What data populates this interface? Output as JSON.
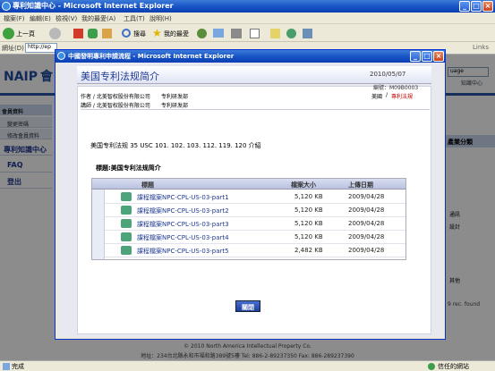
{
  "browser": {
    "title": "專利知識中心 - Microsoft Internet Explorer",
    "menu": [
      "檔案(F)",
      "編輯(E)",
      "檢視(V)",
      "我的最愛(A)",
      "工具(T)",
      "說明(H)"
    ],
    "toolbar": {
      "back_label": "上一頁",
      "search_label": "搜尋",
      "favorites_label": "我的最愛"
    },
    "address_label": "網址(D)",
    "address_value": "http://ep",
    "links_label": "Links",
    "status_left": "完成",
    "status_right": "信任的網站"
  },
  "page": {
    "logo_text": "NAIP",
    "logo_sub": "會",
    "header_right": "知識中心",
    "lang_select": "uage",
    "side": {
      "member_header": "會員資料",
      "items": [
        "變更密碼",
        "修改會員資料"
      ],
      "nav": [
        "專利知識中心",
        "FAQ",
        "登出"
      ]
    },
    "right_col": {
      "header": "產業分類",
      "items": [
        "通訊",
        "設計",
        "其他"
      ],
      "footer": "9 rec. found"
    },
    "footer_copy": "© 2010 North America Intellectual Property Co.",
    "footer_addr": "地址：234台北縣永和市福和路389號5樓  Tel: 886-2-89237350  Fax: 886-289237390"
  },
  "popup": {
    "title": "中國發明專利申請流程 - Microsoft Internet Explorer",
    "heading": "美国专利法规简介",
    "date": "2010/05/07",
    "code_label": "編號：M09B0003",
    "author_label": "作者 / 北美智权股份有限公司",
    "author_dept": "专利研发部",
    "lecturer_label": "講師 / 北美智权股份有限公司",
    "lecturer_dept": "专利研发部",
    "category_left": "美國",
    "category_sep": "/",
    "category_right": "專利法規",
    "intro": "美国专利法规 35 USC 101. 102. 103. 112. 119. 120 介紹",
    "table_title": "標題:美国专利法规简介",
    "columns": [
      "標題",
      "檔案大小",
      "上傳日期"
    ],
    "rows": [
      {
        "name": "課程檔案NPC-CPL-US-03-part1",
        "size": "5,120 KB",
        "date": "2009/04/28"
      },
      {
        "name": "課程檔案NPC-CPL-US-03-part2",
        "size": "5,120 KB",
        "date": "2009/04/28"
      },
      {
        "name": "課程檔案NPC-CPL-US-03-part3",
        "size": "5,120 KB",
        "date": "2009/04/28"
      },
      {
        "name": "課程檔案NPC-CPL-US-03-part4",
        "size": "5,120 KB",
        "date": "2009/04/28"
      },
      {
        "name": "課程檔案NPC-CPL-US-03-part5",
        "size": "2,482 KB",
        "date": "2009/04/28"
      }
    ],
    "close_label": "關閉"
  },
  "colors": {
    "xp_blue": "#0b3fb3",
    "heading": "#1f3a93",
    "accent_red": "#c00000",
    "link_blue": "#1f3f9e"
  }
}
